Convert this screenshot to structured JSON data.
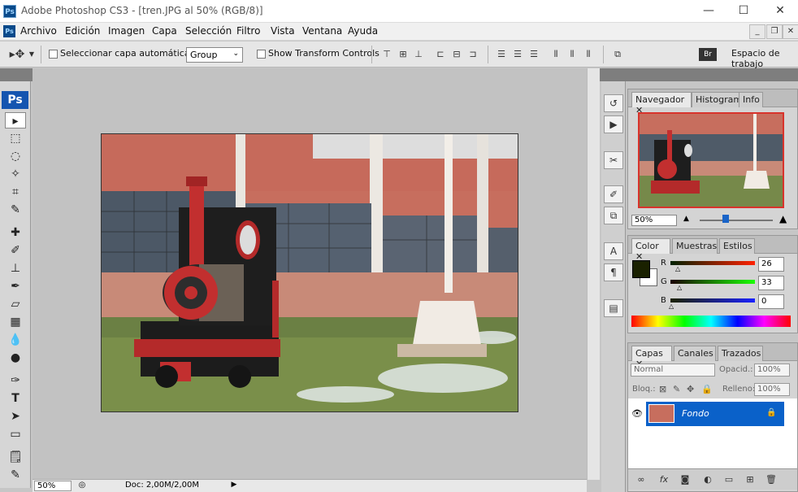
{
  "window": {
    "title": "Adobe Photoshop CS3 - [tren.JPG al 50% (RGB/8)]",
    "app_icon": "Ps",
    "minimize": "—",
    "maximize": "☐",
    "close": "✕"
  },
  "menu": [
    "Archivo",
    "Edición",
    "Imagen",
    "Capa",
    "Selección",
    "Filtro",
    "Vista",
    "Ventana",
    "Ayuda"
  ],
  "options": {
    "auto_select_label": "Seleccionar capa automáticamente",
    "group_value": "Group",
    "transform_label": "Show Transform Controls",
    "workspace_label": "Espacio de trabajo"
  },
  "toolbox": {
    "logo": "Ps"
  },
  "status": {
    "zoom": "50%",
    "doc": "Doc: 2,00M/2,00M"
  },
  "navigator": {
    "tabs": [
      "Navegador",
      "Histograma",
      "Info"
    ],
    "zoom": "50%"
  },
  "color_panel": {
    "tabs": [
      "Color",
      "Muestras",
      "Estilos"
    ],
    "r_label": "R",
    "g_label": "G",
    "b_label": "B",
    "r": "26",
    "g": "33",
    "b": "0",
    "fg_color": "#1a2100"
  },
  "layers_panel": {
    "tabs": [
      "Capas",
      "Canales",
      "Trazados"
    ],
    "blend_mode": "Normal",
    "opacity_label": "Opacid.:",
    "opacity": "100%",
    "lock_label": "Bloq.:",
    "fill_label": "Relleno:",
    "fill": "100%",
    "layer_name": "Fondo"
  }
}
